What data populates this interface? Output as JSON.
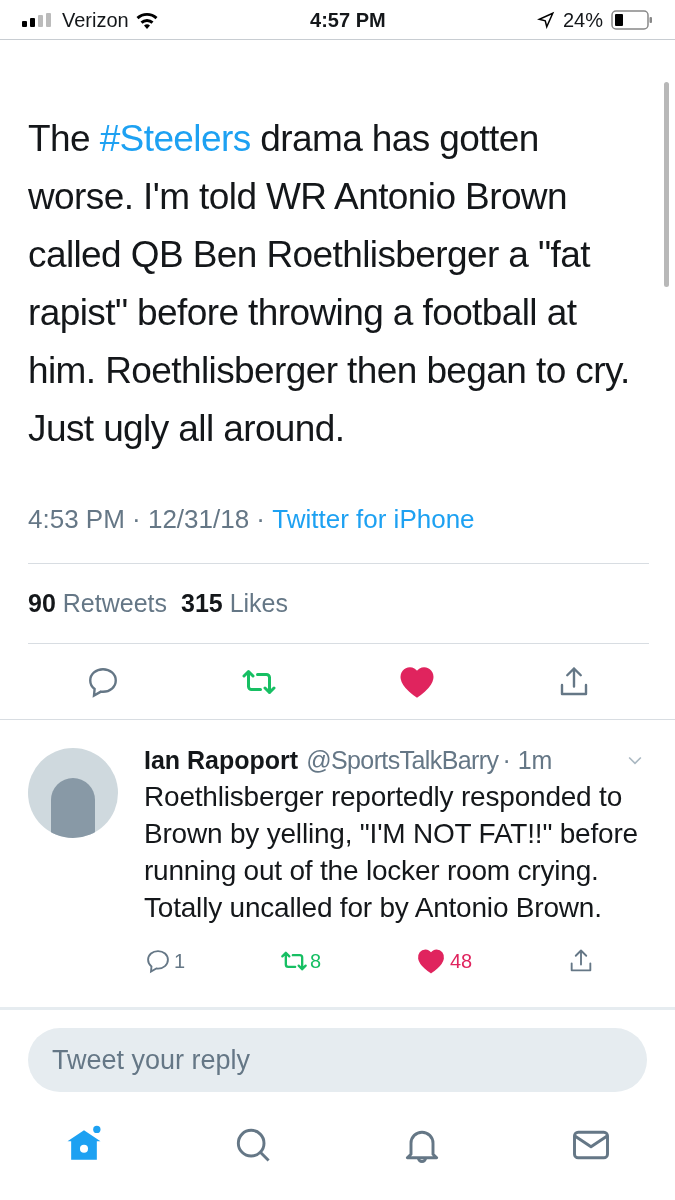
{
  "status_bar": {
    "carrier": "Verizon",
    "time": "4:57 PM",
    "battery": "24%"
  },
  "tweet": {
    "text_parts": [
      {
        "kind": "plain",
        "text": "The "
      },
      {
        "kind": "hashtag",
        "text": "#Steelers"
      },
      {
        "kind": "plain",
        "text": " drama has gotten worse. I'm told WR Antonio Brown called QB Ben Roethlisberger a \"fat rapist\" before throwing a football at him. Roethlisberger then began to cry. Just ugly all around."
      }
    ],
    "meta": "4:53 PM · 12/31/18 · ",
    "source": "Twitter for iPhone",
    "retweet_count": "90",
    "retweet_label": "Retweets",
    "like_count": "315",
    "like_label": "Likes",
    "retweeted": true,
    "liked": true
  },
  "reply": {
    "name": "Ian Rapoport",
    "handle": "@SportsTalkBarry",
    "time": "· 1m",
    "text": "Roethlisberger reportedly responded to Brown by yelling, \"I'M NOT FAT!!\" before running out of the locker room crying. Totally uncalled for by Antonio Brown.",
    "reply_count": "1",
    "retweet_count": "8",
    "like_count": "48",
    "retweeted": true,
    "liked": true
  },
  "reply_field": {
    "placeholder": "Tweet your reply"
  },
  "tab_bar": [
    {
      "kind": "home",
      "selected": true
    },
    {
      "kind": "search",
      "selected": false
    },
    {
      "kind": "notifications",
      "selected": false
    },
    {
      "kind": "messages",
      "selected": false
    }
  ]
}
